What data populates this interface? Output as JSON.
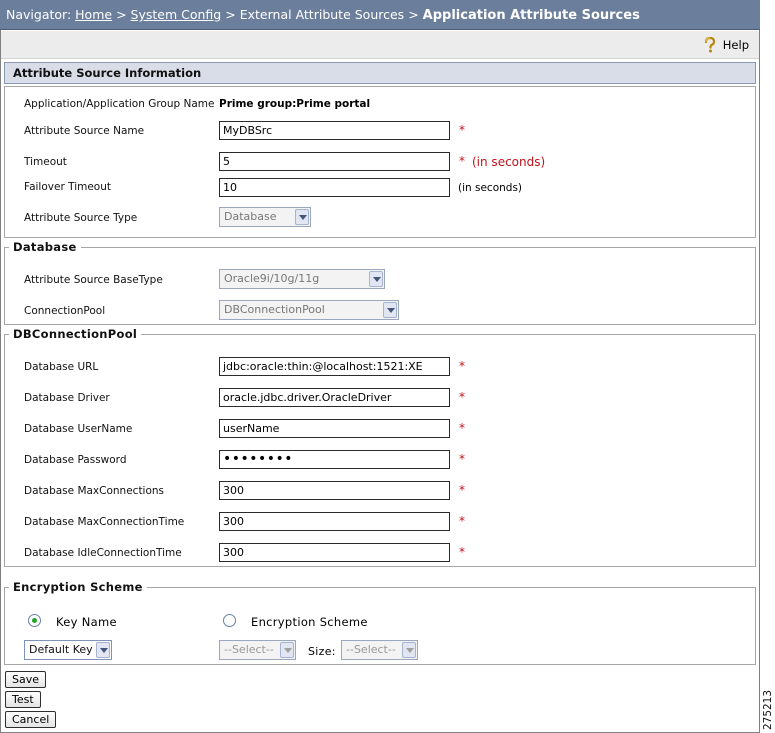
{
  "breadcrumb": {
    "prefix": "Navigator:",
    "home": "Home",
    "system_config": "System Config",
    "external_attribute_sources": "External Attribute Sources",
    "current": "Application Attribute Sources",
    "separator": ">"
  },
  "help_label": "Help",
  "attribute_source_info": {
    "title": "Attribute Source Information",
    "app_group_label": "Application/Application Group Name",
    "app_group_value": "Prime group:Prime portal",
    "source_name_label": "Attribute Source Name",
    "source_name_value": "MyDBSrc",
    "timeout_label": "Timeout",
    "timeout_value": "5",
    "timeout_note": "(in seconds)",
    "failover_label": "Failover Timeout",
    "failover_value": "10",
    "failover_note": "(in seconds)",
    "source_type_label": "Attribute Source Type",
    "source_type_value": "Database",
    "required_mark": "*"
  },
  "database": {
    "title": "Database",
    "basetype_label": "Attribute Source BaseType",
    "basetype_value": "Oracle9i/10g/11g",
    "pool_label": "ConnectionPool",
    "pool_value": "DBConnectionPool"
  },
  "db_connection_pool": {
    "title": "DBConnectionPool",
    "url_label": "Database URL",
    "url_value": "jdbc:oracle:thin:@localhost:1521:XE",
    "driver_label": "Database Driver",
    "driver_value": "oracle.jdbc.driver.OracleDriver",
    "username_label": "Database UserName",
    "username_value": "userName",
    "password_label": "Database Password",
    "password_value": "••••••••",
    "maxconn_label": "Database MaxConnections",
    "maxconn_value": "300",
    "maxconntime_label": "Database MaxConnectionTime",
    "maxconntime_value": "300",
    "idletime_label": "Database IdleConnectionTime",
    "idletime_value": "300"
  },
  "encryption": {
    "title": "Encryption Scheme",
    "key_name_label": "Key Name",
    "scheme_label": "Encryption Scheme",
    "key_select_value": "Default Key",
    "scheme_select_value": "--Select--",
    "size_label": "Size:",
    "size_select_value": "--Select--"
  },
  "buttons": {
    "save": "Save",
    "test": "Test",
    "cancel": "Cancel"
  },
  "figure_id": "275213",
  "colors": {
    "nav_bar": "#6b7f9c",
    "section_header": "#d9dde8",
    "required": "#c0141a",
    "radio_checked": "#27a327"
  }
}
